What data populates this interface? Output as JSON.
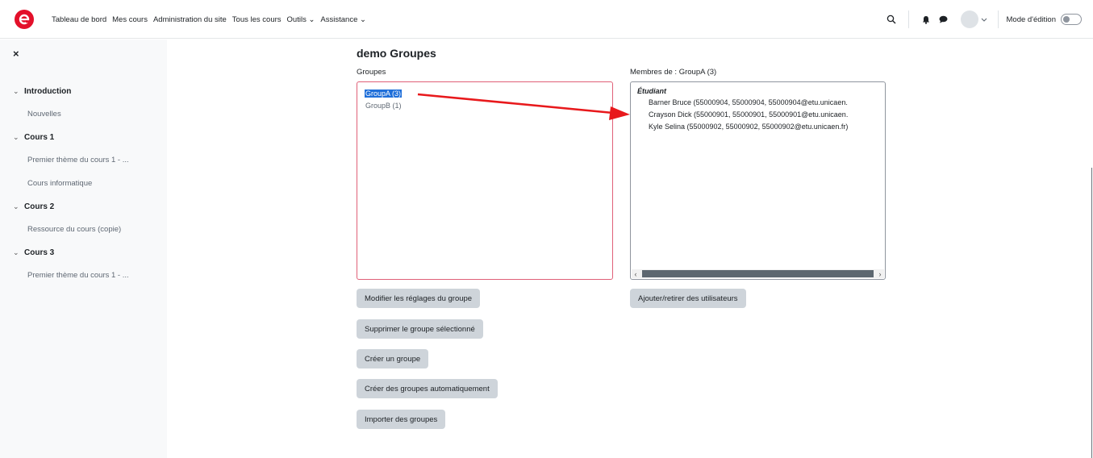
{
  "brand": {
    "accent": "#e3102a"
  },
  "nav": {
    "links": [
      "Tableau de bord",
      "Mes cours",
      "Administration du site",
      "Tous les cours",
      "Outils ⌄",
      "Assistance ⌄"
    ],
    "edit_mode_label": "Mode d'édition"
  },
  "drawer": {
    "close_glyph": "×",
    "sections": [
      {
        "label": "Introduction",
        "items": [
          "Nouvelles"
        ]
      },
      {
        "label": "Cours 1",
        "items": [
          "Premier thème du cours 1 - ...",
          "Cours informatique"
        ]
      },
      {
        "label": "Cours 2",
        "items": [
          "Ressource du cours (copie)"
        ]
      },
      {
        "label": "Cours 3",
        "items": [
          "Premier thème du cours 1 - ..."
        ]
      }
    ]
  },
  "main": {
    "title": "demo Groupes",
    "groups_label": "Groupes",
    "members_label": "Membres de : GroupA (3)",
    "groups": [
      {
        "label": "GroupA (3)",
        "selected": true
      },
      {
        "label": "GroupB (1)",
        "selected": false
      }
    ],
    "members_role": "Étudiant",
    "members": [
      "Barner Bruce (55000904, 55000904, 55000904@etu.unicaen.",
      "Crayson Dick (55000901, 55000901, 55000901@etu.unicaen.",
      "Kyle Selina (55000902, 55000902, 55000902@etu.unicaen.fr)"
    ],
    "buttons": {
      "edit_group": "Modifier les réglages du groupe",
      "delete_group": "Supprimer le groupe sélectionné",
      "create_group": "Créer un groupe",
      "auto_create": "Créer des groupes automatiquement",
      "import_groups": "Importer des groupes",
      "add_remove_users": "Ajouter/retirer des utilisateurs"
    }
  },
  "annotation": {
    "arrow_color": "#e8191c"
  }
}
